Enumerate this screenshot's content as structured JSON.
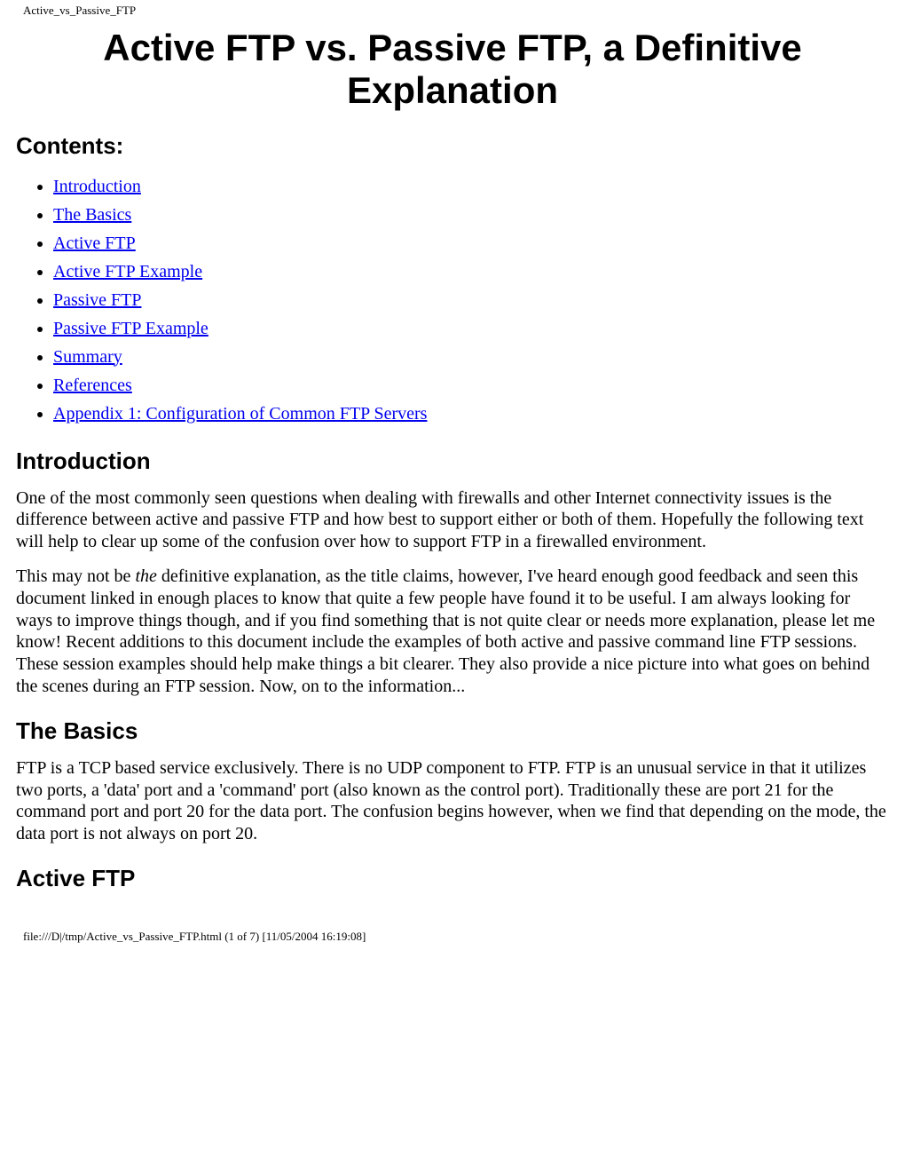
{
  "header": {
    "file_label": "Active_vs_Passive_FTP"
  },
  "title": "Active FTP vs. Passive FTP, a Definitive Explanation",
  "sections": {
    "contents_heading": "Contents:",
    "toc": [
      "Introduction",
      "The Basics",
      "Active FTP",
      "Active FTP Example",
      "Passive FTP",
      "Passive FTP Example",
      "Summary",
      "References",
      "Appendix 1: Configuration of Common FTP Servers"
    ],
    "introduction_heading": "Introduction",
    "introduction_p1": "One of the most commonly seen questions when dealing with firewalls and other Internet connectivity issues is the difference between active and passive FTP and how best to support either or both of them. Hopefully the following text will help to clear up some of the confusion over how to support FTP in a firewalled environment.",
    "introduction_p2_a": "This may not be ",
    "introduction_p2_em": "the",
    "introduction_p2_b": " definitive explanation, as the title claims, however, I've heard enough good feedback and seen this document linked in enough places to know that quite a few people have found it to be useful. I am always looking for ways to improve things though, and if you find something that is not quite clear or needs more explanation, please let me know! Recent additions to this document include the examples of both active and passive command line FTP sessions. These session examples should help make things a bit clearer. They also provide a nice picture into what goes on behind the scenes during an FTP session. Now, on to the information...",
    "basics_heading": "The Basics",
    "basics_p1": "FTP is a TCP based service exclusively. There is no UDP component to FTP. FTP is an unusual service in that it utilizes two ports, a 'data' port and a 'command' port (also known as the control port). Traditionally these are port 21 for the command port and port 20 for the data port. The confusion begins however, when we find that depending on the mode, the data port is not always on port 20.",
    "activeftp_heading": "Active FTP"
  },
  "footer": {
    "line": "file:///D|/tmp/Active_vs_Passive_FTP.html (1 of 7) [11/05/2004 16:19:08]"
  }
}
